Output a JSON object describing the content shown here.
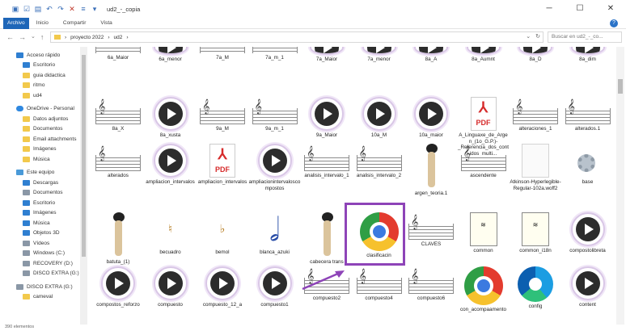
{
  "window": {
    "title": "ud2_-_copia",
    "controls": [
      "─",
      "☐",
      "✕"
    ]
  },
  "ribbon": {
    "tabs": [
      "Archivo",
      "Inicio",
      "Compartir",
      "Vista"
    ],
    "help": "?"
  },
  "address": {
    "path": [
      "proyecto 2022",
      "ud2"
    ],
    "search_placeholder": "Buscar en ud2_-_co..."
  },
  "sidebar": {
    "items": [
      {
        "label": "Acceso rápido",
        "icon": "star-icon"
      },
      {
        "label": "Escritorio",
        "icon": "desktop-icon"
      },
      {
        "label": "guia didactica",
        "icon": "folder-icon"
      },
      {
        "label": "ritmo",
        "icon": "folder-icon"
      },
      {
        "label": "ud4",
        "icon": "folder-icon"
      },
      {
        "label": "OneDrive - Personal",
        "icon": "cloud-icon"
      },
      {
        "label": "Datos adjuntos",
        "icon": "folder-icon"
      },
      {
        "label": "Documentos",
        "icon": "folder-icon"
      },
      {
        "label": "Email attachments",
        "icon": "folder-icon"
      },
      {
        "label": "Imágenes",
        "icon": "folder-icon"
      },
      {
        "label": "Música",
        "icon": "folder-icon"
      },
      {
        "label": "Este equipo",
        "icon": "pc-icon"
      },
      {
        "label": "Descargas",
        "icon": "download-icon"
      },
      {
        "label": "Documentos",
        "icon": "documents-icon"
      },
      {
        "label": "Escritorio",
        "icon": "desktop-icon"
      },
      {
        "label": "Imágenes",
        "icon": "pictures-icon"
      },
      {
        "label": "Música",
        "icon": "music-icon"
      },
      {
        "label": "Objetos 3D",
        "icon": "cube-icon"
      },
      {
        "label": "Vídeos",
        "icon": "video-icon"
      },
      {
        "label": "Windows (C:)",
        "icon": "drive-icon"
      },
      {
        "label": "RECOVERY (D:)",
        "icon": "drive-icon"
      },
      {
        "label": "DISCO EXTRA (G:)",
        "icon": "drive-icon"
      },
      {
        "label": "DISCO EXTRA (G:)",
        "icon": "drive-icon"
      },
      {
        "label": "cameval",
        "icon": "folder-icon"
      }
    ]
  },
  "files": {
    "row1": [
      "6a_Maior",
      "6a_menor",
      "7a_M",
      "7a_m_1",
      "7a_Maior",
      "7a_menor",
      "8a_A",
      "8a_Aumnt",
      "8a_D",
      "8a_dim"
    ],
    "row2": [
      "8a_X",
      "8a_xusta",
      "9a_M",
      "9a_m_1",
      "9a_Maior",
      "10a_M",
      "10a_maior",
      "A_Linguaxe_de_Argen_(1o_G.P.)-_Referencia_dos_contidos_multi...",
      "alteraciones_1",
      "alterados.1"
    ],
    "row3": [
      "alterados",
      "ampliacion_intervalos",
      "ampliacion_intervalos",
      "ampliacionintervaloscompostos",
      "analisis_intervalo_1",
      "analisis_intervalo_2",
      "argen_teoria.1",
      "ascendente",
      "Atkinson-Hyperlegible-Regular-102a.woff2",
      "base"
    ],
    "row4": [
      "batuta_(1)",
      "becuadro",
      "bemol",
      "blanca_azuki",
      "cabecera trans",
      "clasificacin",
      "CLAVES",
      "common",
      "common_i18n",
      "compostolibreta"
    ],
    "row5": [
      "compostos_reforzo",
      "compuesto",
      "compuesto_12_a",
      "compuesto1",
      "compuesto2",
      "compuesto4",
      "compuesto6",
      "con_acompaamento",
      "config",
      "content"
    ]
  },
  "status": {
    "items_count": "390 elementos"
  }
}
